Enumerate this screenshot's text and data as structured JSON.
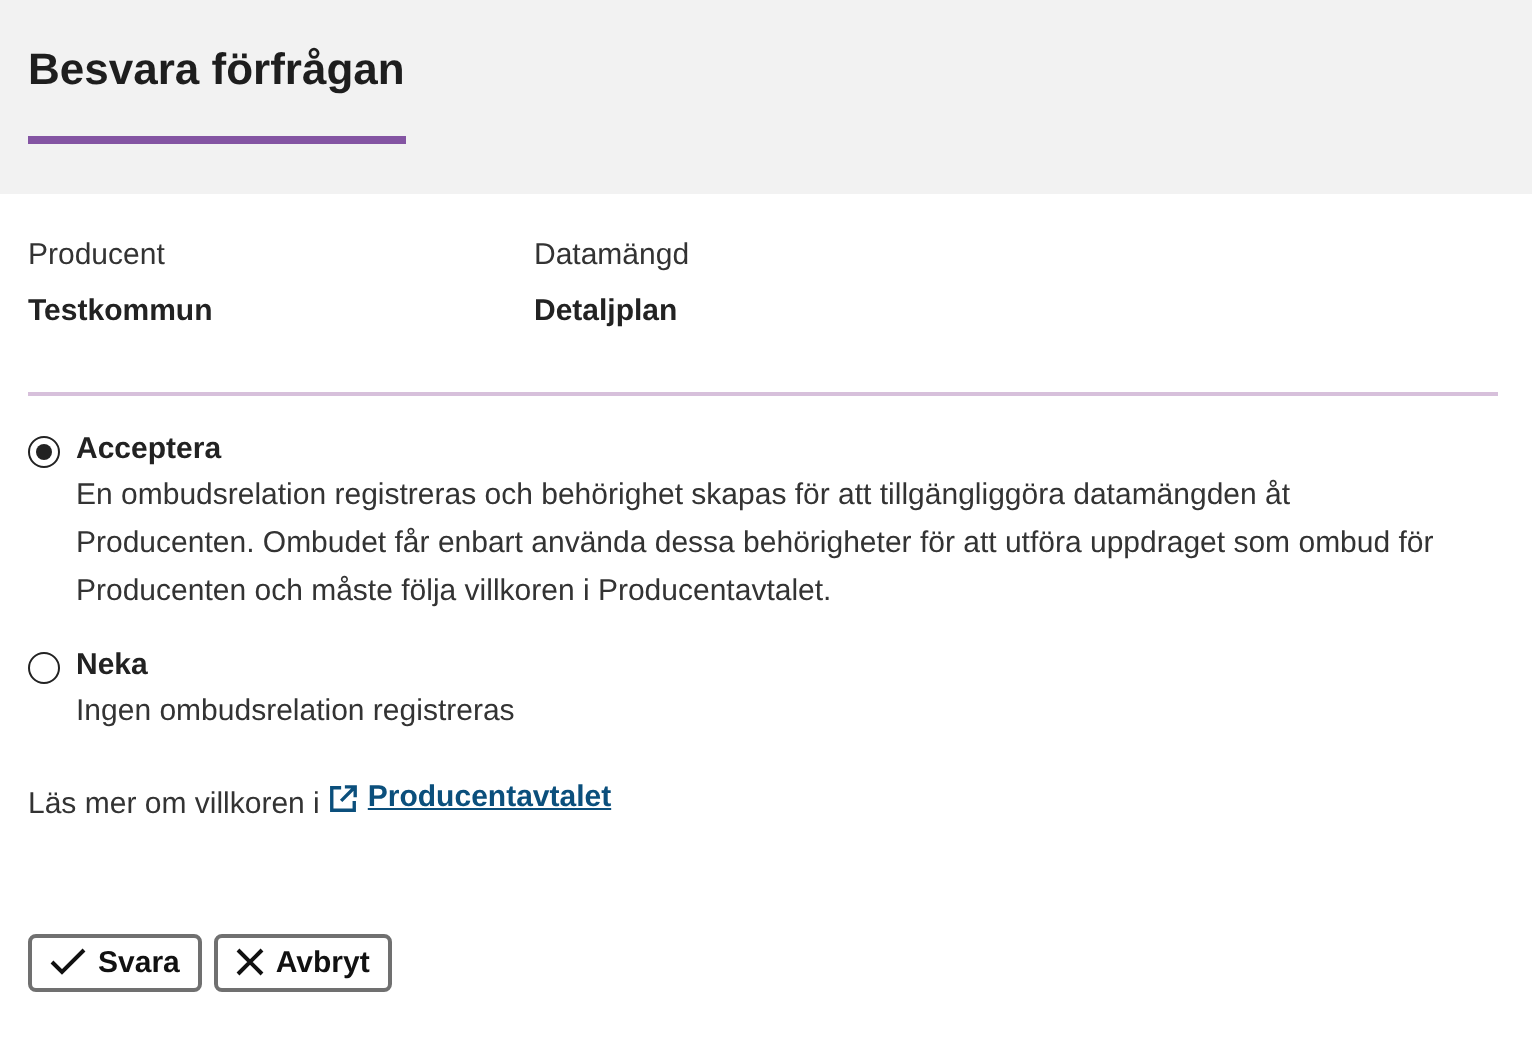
{
  "header": {
    "title": "Besvara förfrågan"
  },
  "fields": [
    {
      "label": "Producent",
      "value": "Testkommun"
    },
    {
      "label": "Datamängd",
      "value": "Detaljplan"
    }
  ],
  "options": [
    {
      "label": "Acceptera",
      "description": "En ombudsrelation registreras och behörighet skapas för att tillgängliggöra datamängden åt Producenten. Ombudet får enbart använda dessa behörigheter för att utföra uppdraget som ombud för Producenten och måste följa villkoren i Producentavtalet.",
      "selected": true
    },
    {
      "label": "Neka",
      "description": "Ingen ombudsrelation registreras",
      "selected": false
    }
  ],
  "terms": {
    "text": "Läs mer om villkoren i",
    "link": "Producentavtalet"
  },
  "buttons": [
    {
      "kind": "confirm",
      "label": "Svara"
    },
    {
      "kind": "cancel",
      "label": "Avbryt"
    }
  ]
}
